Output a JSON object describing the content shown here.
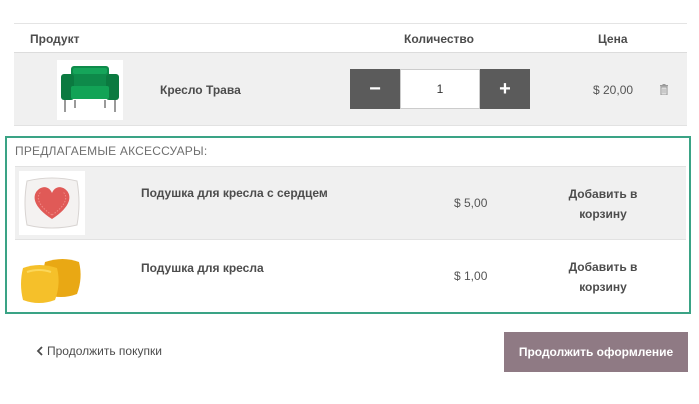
{
  "table": {
    "col_product": "Продукт",
    "col_quantity": "Количество",
    "col_price": "Цена"
  },
  "cart_items": [
    {
      "name": "Кресло Трава",
      "quantity": "1",
      "price": "$ 20,00",
      "image_icon": "green-armchair-icon",
      "minus": "−",
      "plus": "+"
    }
  ],
  "accessories": {
    "title": "ПРЕДЛАГАЕМЫЕ АКСЕССУАРЫ:",
    "items": [
      {
        "name": "Подушка для кресла с сердцем",
        "price": "$ 5,00",
        "add_label": "Добавить в корзину",
        "image_icon": "heart-pillow-icon"
      },
      {
        "name": "Подушка для кресла",
        "price": "$ 1,00",
        "add_label": "Добавить в корзину",
        "image_icon": "yellow-pillows-icon"
      }
    ]
  },
  "footer": {
    "continue_shopping": "Продолжить покупки",
    "checkout": "Продолжить оформление"
  },
  "colors": {
    "accent_border": "#3aa385",
    "checkout_bg": "#8f7a84",
    "qty_button_bg": "#5b5b5b"
  }
}
